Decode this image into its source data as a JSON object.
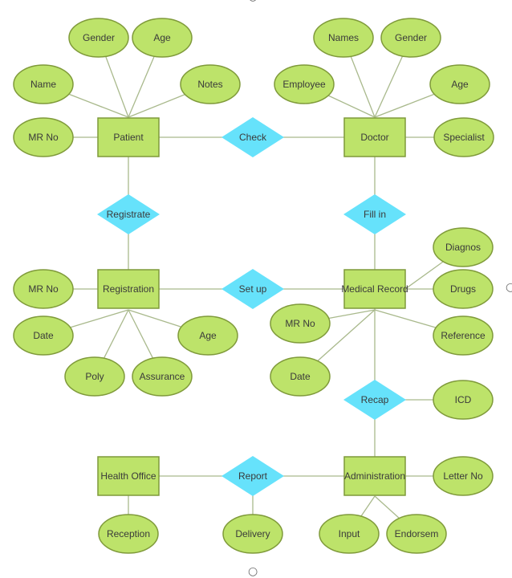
{
  "diagram": {
    "type": "entity-relationship",
    "colors": {
      "entity_fill": "#bde36a",
      "attribute_fill": "#bde36a",
      "relationship_fill": "#66e2fb",
      "line": "#a9b98c",
      "text": "#3a3a3a"
    },
    "entities": [
      {
        "id": "patient",
        "label": "Patient"
      },
      {
        "id": "doctor",
        "label": "Doctor"
      },
      {
        "id": "registration",
        "label": "Registration"
      },
      {
        "id": "medical_record",
        "label": "Medical Record"
      },
      {
        "id": "health_office",
        "label": "Health Office"
      },
      {
        "id": "administration",
        "label": "Administration"
      }
    ],
    "relationships": [
      {
        "id": "check",
        "label": "Check",
        "connects": [
          "patient",
          "doctor"
        ]
      },
      {
        "id": "registrate",
        "label": "Registrate",
        "connects": [
          "patient",
          "registration"
        ]
      },
      {
        "id": "fill_in",
        "label": "Fill in",
        "connects": [
          "doctor",
          "medical_record"
        ]
      },
      {
        "id": "set_up",
        "label": "Set up",
        "connects": [
          "registration",
          "medical_record"
        ]
      },
      {
        "id": "recap",
        "label": "Recap",
        "connects": [
          "medical_record",
          "administration"
        ]
      },
      {
        "id": "report",
        "label": "Report",
        "connects": [
          "health_office",
          "administration"
        ]
      }
    ],
    "attributes": [
      {
        "id": "p_gender",
        "label": "Gender",
        "of": "patient"
      },
      {
        "id": "p_age",
        "label": "Age",
        "of": "patient"
      },
      {
        "id": "p_name",
        "label": "Name",
        "of": "patient"
      },
      {
        "id": "p_notes",
        "label": "Notes",
        "of": "patient"
      },
      {
        "id": "p_mrno",
        "label": "MR No",
        "of": "patient"
      },
      {
        "id": "d_names",
        "label": "Names",
        "of": "doctor"
      },
      {
        "id": "d_gender",
        "label": "Gender",
        "of": "doctor"
      },
      {
        "id": "d_employee",
        "label": "Employee",
        "of": "doctor"
      },
      {
        "id": "d_age",
        "label": "Age",
        "of": "doctor"
      },
      {
        "id": "d_specialist",
        "label": "Specialist",
        "of": "doctor"
      },
      {
        "id": "r_mrno",
        "label": "MR No",
        "of": "registration"
      },
      {
        "id": "r_date",
        "label": "Date",
        "of": "registration"
      },
      {
        "id": "r_age",
        "label": "Age",
        "of": "registration"
      },
      {
        "id": "r_poly",
        "label": "Poly",
        "of": "registration"
      },
      {
        "id": "r_assurance",
        "label": "Assurance",
        "of": "registration"
      },
      {
        "id": "m_diagnos",
        "label": "Diagnos",
        "of": "medical_record"
      },
      {
        "id": "m_drugs",
        "label": "Drugs",
        "of": "medical_record"
      },
      {
        "id": "m_reference",
        "label": "Reference",
        "of": "medical_record"
      },
      {
        "id": "m_mrno",
        "label": "MR No",
        "of": "medical_record"
      },
      {
        "id": "m_date",
        "label": "Date",
        "of": "medical_record"
      },
      {
        "id": "rc_icd",
        "label": "ICD",
        "of": "recap"
      },
      {
        "id": "a_letterno",
        "label": "Letter No",
        "of": "administration"
      },
      {
        "id": "a_input",
        "label": "Input",
        "of": "administration"
      },
      {
        "id": "a_endorsem",
        "label": "Endorsem",
        "of": "administration"
      },
      {
        "id": "h_reception",
        "label": "Reception",
        "of": "health_office"
      },
      {
        "id": "rp_delivery",
        "label": "Delivery",
        "of": "report"
      }
    ]
  }
}
